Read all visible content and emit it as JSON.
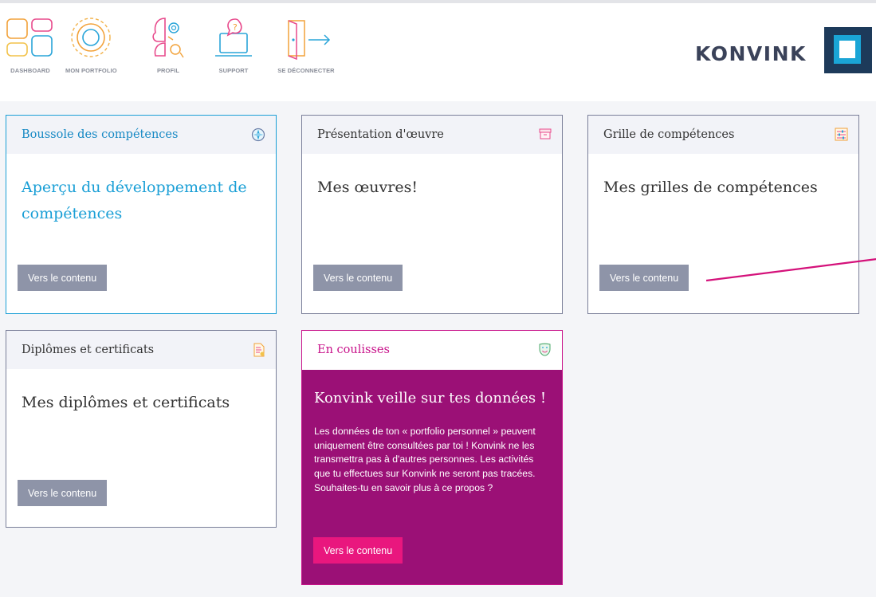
{
  "nav": {
    "items": [
      {
        "label": "DASHBOARD",
        "icon": "dashboard-icon"
      },
      {
        "label": "MON PORTFOLIO",
        "icon": "portfolio-icon"
      },
      {
        "label": "PROFIL",
        "icon": "profile-icon"
      },
      {
        "label": "SUPPORT",
        "icon": "support-icon"
      },
      {
        "label": "SE DÉCONNECTER",
        "icon": "logout-icon"
      }
    ]
  },
  "brand": {
    "name": "KONVINK"
  },
  "cards": [
    {
      "title": "Boussole des compétences",
      "main": "Aperçu du développement de compétences",
      "button": "Vers le contenu",
      "icon": "compass-icon"
    },
    {
      "title": "Présentation d'œuvre",
      "main": "Mes œuvres!",
      "button": "Vers le contenu",
      "icon": "archive-box-icon"
    },
    {
      "title": "Grille de compétences",
      "main": "Mes grilles de compétences",
      "button": "Vers le contenu",
      "icon": "sliders-icon"
    },
    {
      "title": "Diplômes et certificats",
      "main": "Mes diplômes et certificats",
      "button": "Vers le contenu",
      "icon": "certificate-icon"
    }
  ],
  "backstage": {
    "title": "En coulisses",
    "icon": "masks-icon",
    "headline": "Konvink veille sur tes données !",
    "text": "Les données de ton « portfolio personnel » peuvent uniquement être consultées par toi ! Konvink ne les transmettra pas à d'autres personnes. Les activités que tu effectues sur Konvink ne seront pas tracées. Souhaites-tu en savoir plus à ce propos ?",
    "button": "Vers le contenu"
  },
  "colors": {
    "accent_blue": "#1a9fd6",
    "accent_magenta": "#9b1076",
    "button_pink": "#e9177e",
    "button_grey": "#8e94a8",
    "annotation_line": "#d4117a"
  }
}
